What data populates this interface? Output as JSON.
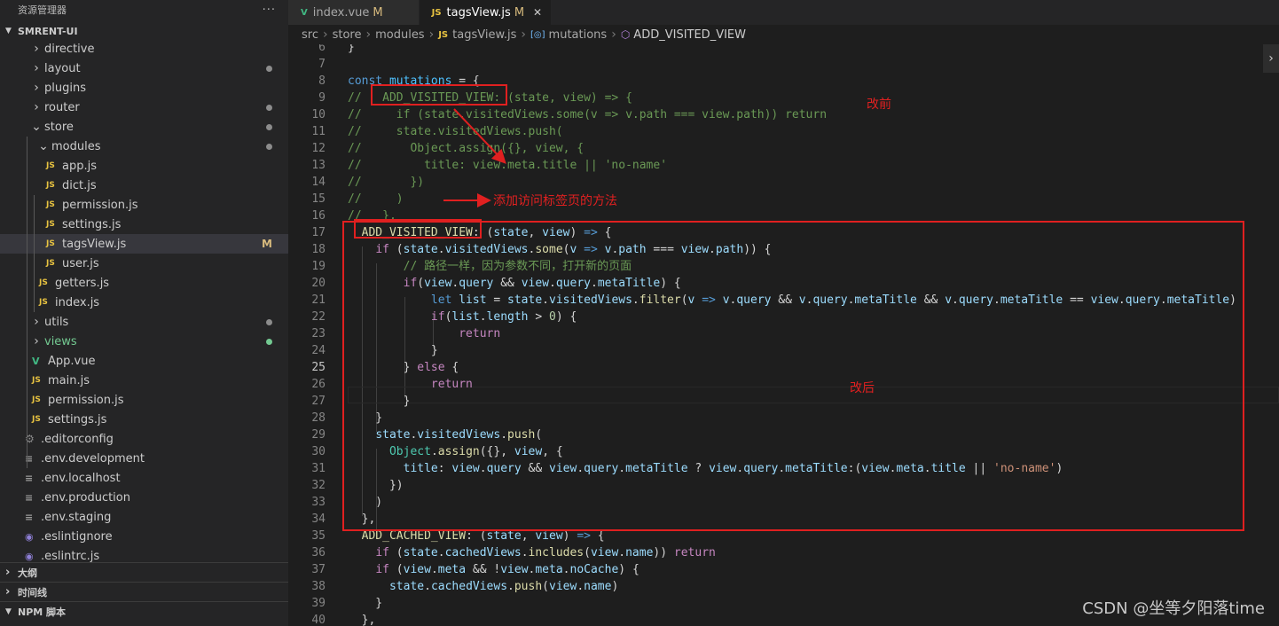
{
  "sidebar": {
    "title": "资源管理器",
    "more": "···",
    "project": "SMRENT-UI",
    "tree": [
      {
        "label": "directive",
        "kind": "folder",
        "indent": 1,
        "open": false,
        "dot": ""
      },
      {
        "label": "layout",
        "kind": "folder",
        "indent": 1,
        "open": false,
        "dot": "gray"
      },
      {
        "label": "plugins",
        "kind": "folder",
        "indent": 1,
        "open": false,
        "dot": ""
      },
      {
        "label": "router",
        "kind": "folder",
        "indent": 1,
        "open": false,
        "dot": "gray"
      },
      {
        "label": "store",
        "kind": "folder",
        "indent": 1,
        "open": true,
        "dot": "gray"
      },
      {
        "label": "modules",
        "kind": "folder",
        "indent": 2,
        "open": true,
        "dot": "gray"
      },
      {
        "label": "app.js",
        "kind": "js",
        "indent": 3,
        "dot": ""
      },
      {
        "label": "dict.js",
        "kind": "js",
        "indent": 3,
        "dot": ""
      },
      {
        "label": "permission.js",
        "kind": "js",
        "indent": 3,
        "dot": ""
      },
      {
        "label": "settings.js",
        "kind": "js",
        "indent": 3,
        "dot": ""
      },
      {
        "label": "tagsView.js",
        "kind": "js",
        "indent": 3,
        "dot": "",
        "mark": "M",
        "selected": true
      },
      {
        "label": "user.js",
        "kind": "js",
        "indent": 3,
        "dot": ""
      },
      {
        "label": "getters.js",
        "kind": "js",
        "indent": 2,
        "dot": ""
      },
      {
        "label": "index.js",
        "kind": "js",
        "indent": 2,
        "dot": ""
      },
      {
        "label": "utils",
        "kind": "folder",
        "indent": 1,
        "open": false,
        "dot": "gray"
      },
      {
        "label": "views",
        "kind": "folder",
        "indent": 1,
        "open": false,
        "dot": "green",
        "green": true
      },
      {
        "label": "App.vue",
        "kind": "vue",
        "indent": 1,
        "dot": ""
      },
      {
        "label": "main.js",
        "kind": "js",
        "indent": 1,
        "dot": ""
      },
      {
        "label": "permission.js",
        "kind": "js",
        "indent": 1,
        "dot": ""
      },
      {
        "label": "settings.js",
        "kind": "js",
        "indent": 1,
        "dot": ""
      },
      {
        "label": ".editorconfig",
        "kind": "gear",
        "indent": 0,
        "dot": ""
      },
      {
        "label": ".env.development",
        "kind": "eq",
        "indent": 0,
        "dot": ""
      },
      {
        "label": ".env.localhost",
        "kind": "eq",
        "indent": 0,
        "dot": ""
      },
      {
        "label": ".env.production",
        "kind": "eq",
        "indent": 0,
        "dot": ""
      },
      {
        "label": ".env.staging",
        "kind": "eq",
        "indent": 0,
        "dot": ""
      },
      {
        "label": ".eslintignore",
        "kind": "es",
        "indent": 0,
        "dot": ""
      },
      {
        "label": ".eslintrc.js",
        "kind": "es",
        "indent": 0,
        "dot": ""
      }
    ],
    "panels": [
      "大纲",
      "时间线",
      "NPM 脚本"
    ]
  },
  "tabs": [
    {
      "label": "index.vue",
      "icon": "V",
      "mark": "M",
      "active": false
    },
    {
      "label": "tagsView.js",
      "icon": "JS",
      "mark": "M",
      "active": true
    }
  ],
  "breadcrumb": [
    "src",
    "store",
    "modules",
    "tagsView.js",
    "mutations",
    "ADD_VISITED_VIEW"
  ],
  "code": {
    "first_line": 6,
    "current_line": 25,
    "lines": [
      [
        [
          "p",
          "}"
        ]
      ],
      [],
      [
        [
          "k",
          "const "
        ],
        [
          "o",
          "mutations"
        ],
        [
          "p",
          " = {"
        ]
      ],
      [
        [
          "cm",
          "//   ADD_VISITED_VIEW: (state, view) => {"
        ]
      ],
      [
        [
          "cm",
          "//     if (state.visitedViews.some(v => v.path === view.path)) return"
        ]
      ],
      [
        [
          "cm",
          "//     state.visitedViews.push("
        ]
      ],
      [
        [
          "cm",
          "//       Object.assign({}, view, {"
        ]
      ],
      [
        [
          "cm",
          "//         title: view.meta.title || 'no-name'"
        ]
      ],
      [
        [
          "cm",
          "//       })"
        ]
      ],
      [
        [
          "cm",
          "//     )"
        ]
      ],
      [
        [
          "cm",
          "//   },"
        ]
      ],
      [
        [
          "p",
          "  "
        ],
        [
          "f",
          "ADD_VISITED_VIEW"
        ],
        [
          "p",
          ": ("
        ],
        [
          "v",
          "state"
        ],
        [
          "p",
          ", "
        ],
        [
          "v",
          "view"
        ],
        [
          "p",
          ") "
        ],
        [
          "k",
          "=>"
        ],
        [
          "p",
          " {"
        ]
      ],
      [
        [
          "p",
          "    "
        ],
        [
          "c",
          "if"
        ],
        [
          "p",
          " ("
        ],
        [
          "v",
          "state"
        ],
        [
          "p",
          "."
        ],
        [
          "v",
          "visitedViews"
        ],
        [
          "p",
          "."
        ],
        [
          "f",
          "some"
        ],
        [
          "p",
          "("
        ],
        [
          "v",
          "v"
        ],
        [
          "p",
          " "
        ],
        [
          "k",
          "=>"
        ],
        [
          "p",
          " "
        ],
        [
          "v",
          "v"
        ],
        [
          "p",
          "."
        ],
        [
          "v",
          "path"
        ],
        [
          "p",
          " === "
        ],
        [
          "v",
          "view"
        ],
        [
          "p",
          "."
        ],
        [
          "v",
          "path"
        ],
        [
          "p",
          ")) {"
        ]
      ],
      [
        [
          "p",
          "        "
        ],
        [
          "cm",
          "// 路径一样，因为参数不同，打开新的页面"
        ]
      ],
      [
        [
          "p",
          "        "
        ],
        [
          "c",
          "if"
        ],
        [
          "p",
          "("
        ],
        [
          "v",
          "view"
        ],
        [
          "p",
          "."
        ],
        [
          "v",
          "query"
        ],
        [
          "p",
          " && "
        ],
        [
          "v",
          "view"
        ],
        [
          "p",
          "."
        ],
        [
          "v",
          "query"
        ],
        [
          "p",
          "."
        ],
        [
          "v",
          "metaTitle"
        ],
        [
          "p",
          ") {"
        ]
      ],
      [
        [
          "p",
          "            "
        ],
        [
          "k",
          "let "
        ],
        [
          "v",
          "list"
        ],
        [
          "p",
          " = "
        ],
        [
          "v",
          "state"
        ],
        [
          "p",
          "."
        ],
        [
          "v",
          "visitedViews"
        ],
        [
          "p",
          "."
        ],
        [
          "f",
          "filter"
        ],
        [
          "p",
          "("
        ],
        [
          "v",
          "v"
        ],
        [
          "p",
          " "
        ],
        [
          "k",
          "=>"
        ],
        [
          "p",
          " "
        ],
        [
          "v",
          "v"
        ],
        [
          "p",
          "."
        ],
        [
          "v",
          "query"
        ],
        [
          "p",
          " && "
        ],
        [
          "v",
          "v"
        ],
        [
          "p",
          "."
        ],
        [
          "v",
          "query"
        ],
        [
          "p",
          "."
        ],
        [
          "v",
          "metaTitle"
        ],
        [
          "p",
          " && "
        ],
        [
          "v",
          "v"
        ],
        [
          "p",
          "."
        ],
        [
          "v",
          "query"
        ],
        [
          "p",
          "."
        ],
        [
          "v",
          "metaTitle"
        ],
        [
          "p",
          " == "
        ],
        [
          "v",
          "view"
        ],
        [
          "p",
          "."
        ],
        [
          "v",
          "query"
        ],
        [
          "p",
          "."
        ],
        [
          "v",
          "metaTitle"
        ],
        [
          "p",
          ")"
        ]
      ],
      [
        [
          "p",
          "            "
        ],
        [
          "c",
          "if"
        ],
        [
          "p",
          "("
        ],
        [
          "v",
          "list"
        ],
        [
          "p",
          "."
        ],
        [
          "v",
          "length"
        ],
        [
          "p",
          " > "
        ],
        [
          "n",
          "0"
        ],
        [
          "p",
          ") {"
        ]
      ],
      [
        [
          "p",
          "                "
        ],
        [
          "c",
          "return"
        ]
      ],
      [
        [
          "p",
          "            }"
        ]
      ],
      [
        [
          "p",
          "        } "
        ],
        [
          "c",
          "else"
        ],
        [
          "p",
          " {"
        ]
      ],
      [
        [
          "p",
          "            "
        ],
        [
          "c",
          "return"
        ]
      ],
      [
        [
          "p",
          "        }"
        ]
      ],
      [
        [
          "p",
          "    }"
        ]
      ],
      [
        [
          "p",
          "    "
        ],
        [
          "v",
          "state"
        ],
        [
          "p",
          "."
        ],
        [
          "v",
          "visitedViews"
        ],
        [
          "p",
          "."
        ],
        [
          "f",
          "push"
        ],
        [
          "p",
          "("
        ]
      ],
      [
        [
          "p",
          "      "
        ],
        [
          "ty",
          "Object"
        ],
        [
          "p",
          "."
        ],
        [
          "f",
          "assign"
        ],
        [
          "p",
          "({}, "
        ],
        [
          "v",
          "view"
        ],
        [
          "p",
          ", {"
        ]
      ],
      [
        [
          "p",
          "        "
        ],
        [
          "v",
          "title"
        ],
        [
          "p",
          ": "
        ],
        [
          "v",
          "view"
        ],
        [
          "p",
          "."
        ],
        [
          "v",
          "query"
        ],
        [
          "p",
          " && "
        ],
        [
          "v",
          "view"
        ],
        [
          "p",
          "."
        ],
        [
          "v",
          "query"
        ],
        [
          "p",
          "."
        ],
        [
          "v",
          "metaTitle"
        ],
        [
          "p",
          " ? "
        ],
        [
          "v",
          "view"
        ],
        [
          "p",
          "."
        ],
        [
          "v",
          "query"
        ],
        [
          "p",
          "."
        ],
        [
          "v",
          "metaTitle"
        ],
        [
          "p",
          ":("
        ],
        [
          "v",
          "view"
        ],
        [
          "p",
          "."
        ],
        [
          "v",
          "meta"
        ],
        [
          "p",
          "."
        ],
        [
          "v",
          "title"
        ],
        [
          "p",
          " || "
        ],
        [
          "s",
          "'no-name'"
        ],
        [
          "p",
          ")"
        ]
      ],
      [
        [
          "p",
          "      })"
        ]
      ],
      [
        [
          "p",
          "    )"
        ]
      ],
      [
        [
          "p",
          "  },"
        ]
      ],
      [
        [
          "p",
          "  "
        ],
        [
          "f",
          "ADD_CACHED_VIEW"
        ],
        [
          "p",
          ": ("
        ],
        [
          "v",
          "state"
        ],
        [
          "p",
          ", "
        ],
        [
          "v",
          "view"
        ],
        [
          "p",
          ") "
        ],
        [
          "k",
          "=>"
        ],
        [
          "p",
          " {"
        ]
      ],
      [
        [
          "p",
          "    "
        ],
        [
          "c",
          "if"
        ],
        [
          "p",
          " ("
        ],
        [
          "v",
          "state"
        ],
        [
          "p",
          "."
        ],
        [
          "v",
          "cachedViews"
        ],
        [
          "p",
          "."
        ],
        [
          "f",
          "includes"
        ],
        [
          "p",
          "("
        ],
        [
          "v",
          "view"
        ],
        [
          "p",
          "."
        ],
        [
          "v",
          "name"
        ],
        [
          "p",
          ")) "
        ],
        [
          "c",
          "return"
        ]
      ],
      [
        [
          "p",
          "    "
        ],
        [
          "c",
          "if"
        ],
        [
          "p",
          " ("
        ],
        [
          "v",
          "view"
        ],
        [
          "p",
          "."
        ],
        [
          "v",
          "meta"
        ],
        [
          "p",
          " && !"
        ],
        [
          "v",
          "view"
        ],
        [
          "p",
          "."
        ],
        [
          "v",
          "meta"
        ],
        [
          "p",
          "."
        ],
        [
          "v",
          "noCache"
        ],
        [
          "p",
          ") {"
        ]
      ],
      [
        [
          "p",
          "      "
        ],
        [
          "v",
          "state"
        ],
        [
          "p",
          "."
        ],
        [
          "v",
          "cachedViews"
        ],
        [
          "p",
          "."
        ],
        [
          "f",
          "push"
        ],
        [
          "p",
          "("
        ],
        [
          "v",
          "view"
        ],
        [
          "p",
          "."
        ],
        [
          "v",
          "name"
        ],
        [
          "p",
          ")"
        ]
      ],
      [
        [
          "p",
          "    }"
        ]
      ],
      [
        [
          "p",
          "  },"
        ]
      ]
    ]
  },
  "annotations": {
    "before_label": "改前",
    "add_label": "添加访问标签页的方法",
    "after_label": "改后",
    "color": "#e02020"
  },
  "watermark": "CSDN @坐等夕阳落time"
}
